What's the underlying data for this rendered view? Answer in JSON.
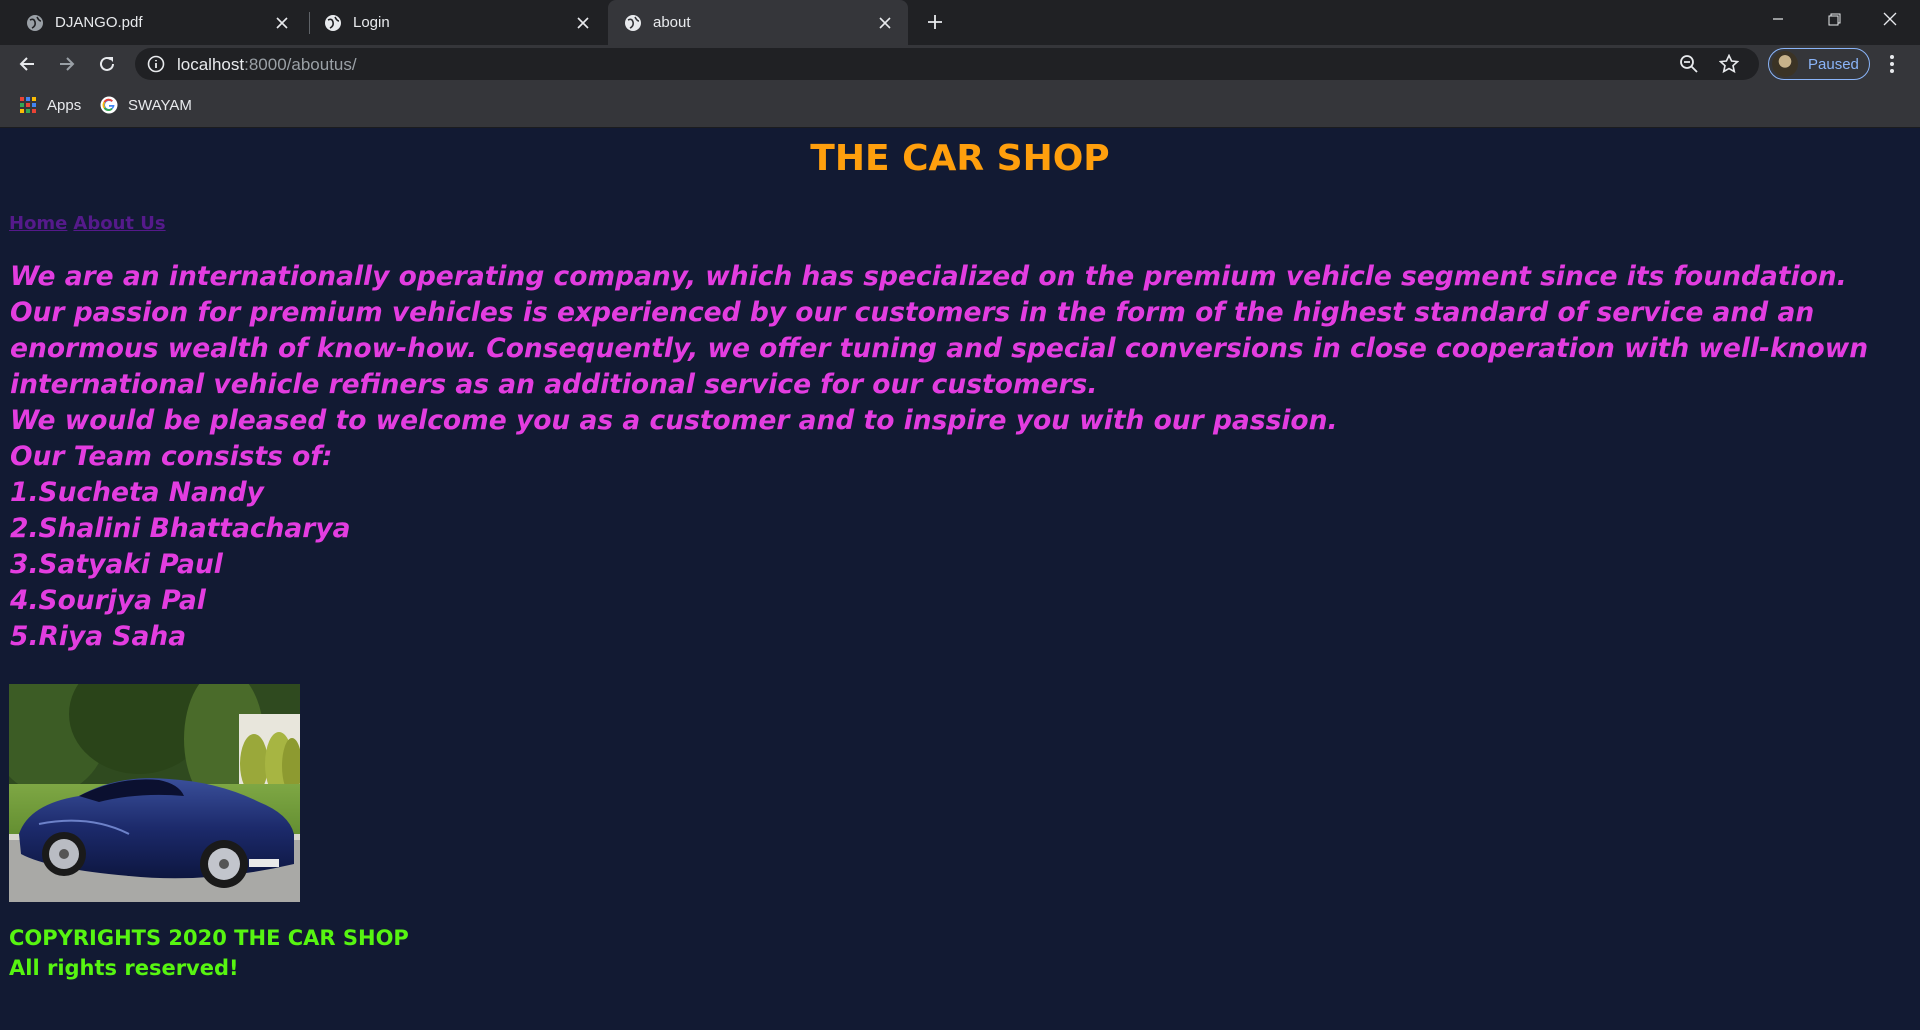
{
  "browser": {
    "tabs": [
      {
        "title": "DJANGO.pdf",
        "icon": "document-globe-icon",
        "active": false
      },
      {
        "title": "Login",
        "icon": "globe-icon",
        "active": false
      },
      {
        "title": "about",
        "icon": "globe-icon",
        "active": true
      }
    ],
    "address": {
      "host": "localhost",
      "path": ":8000/aboutus/"
    },
    "profile_status": "Paused",
    "bookmarks": [
      {
        "label": "Apps",
        "icon": "apps-grid-icon"
      },
      {
        "label": "SWAYAM",
        "icon": "google-g-icon"
      }
    ]
  },
  "page": {
    "title": "THE CAR SHOP",
    "nav": {
      "home": "Home",
      "about": "About Us"
    },
    "about_paragraph": "We are an internationally operating company, which has specialized on the premium vehicle segment since its foundation. Our passion for premium vehicles is experienced by our customers in the form of the highest standard of service and an enormous wealth of know-how. Consequently, we offer tuning and special conversions in close cooperation with well-known international vehicle refiners as an additional service for our customers.",
    "welcome": "We would be pleased to welcome you as a customer and to inspire you with our passion.",
    "team_heading": "Our Team consists of:",
    "team": [
      "1.Sucheta Nandy",
      "2.Shalini Bhattacharya",
      "3.Satyaki Paul",
      "4.Sourjya Pal",
      "5.Riya Saha"
    ],
    "footer": {
      "line1": "COPYRIGHTS 2020 THE CAR SHOP",
      "line2": "All rights reserved!"
    }
  },
  "colors": {
    "page_background": "#121a33",
    "title": "#ff9f0d",
    "body_text": "#e33de0",
    "nav_link": "#551a8b",
    "footer_text": "#57f511"
  }
}
